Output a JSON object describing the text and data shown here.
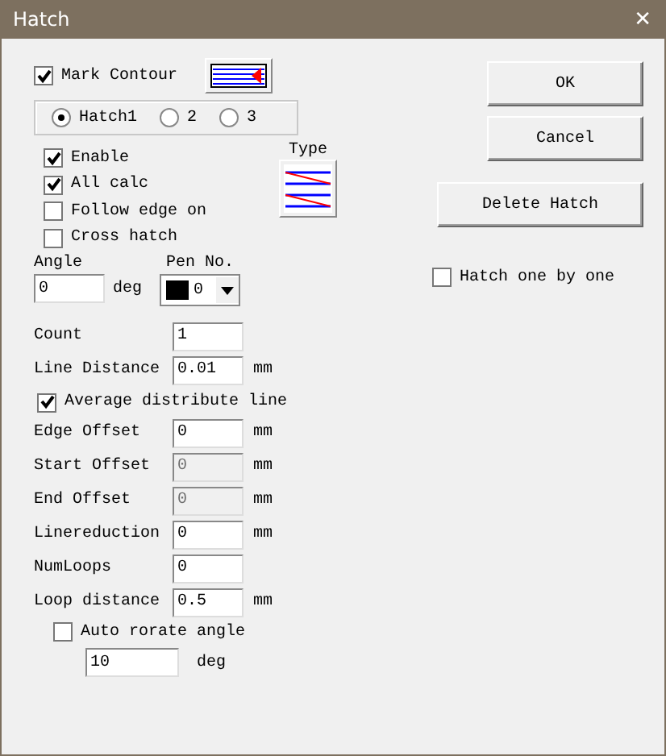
{
  "window": {
    "title": "Hatch",
    "close": "✕"
  },
  "mark_contour": {
    "label": "Mark Contour",
    "checked": true
  },
  "hatch_radios": [
    {
      "label": "Hatch1",
      "selected": true
    },
    {
      "label": "2",
      "selected": false
    },
    {
      "label": "3",
      "selected": false
    }
  ],
  "options": [
    {
      "label": "Enable",
      "checked": true
    },
    {
      "label": "All calc",
      "checked": true
    },
    {
      "label": "Follow edge on",
      "checked": false
    },
    {
      "label": "Cross hatch",
      "checked": false
    }
  ],
  "type_label": "Type",
  "angle": {
    "label": "Angle",
    "value": "0",
    "unit": "deg"
  },
  "pen": {
    "label": "Pen No.",
    "value": "0"
  },
  "fields": [
    {
      "kind": "field",
      "label": "Count",
      "value": "1",
      "disabled": false
    },
    {
      "kind": "field",
      "label": "Line Distance",
      "value": "0.01",
      "unit": "mm",
      "disabled": false
    },
    {
      "kind": "check",
      "label": "Average distribute line",
      "checked": true
    },
    {
      "kind": "field",
      "label": "Edge Offset",
      "value": "0",
      "unit": "mm",
      "disabled": false
    },
    {
      "kind": "field",
      "label": "Start Offset",
      "value": "0",
      "unit": "mm",
      "disabled": true
    },
    {
      "kind": "field",
      "label": "End Offset",
      "value": "0",
      "unit": "mm",
      "disabled": true
    },
    {
      "kind": "field",
      "label": "Linereduction",
      "value": "0",
      "unit": "mm",
      "disabled": false
    },
    {
      "kind": "field",
      "label": "NumLoops",
      "value": "0",
      "disabled": false
    },
    {
      "kind": "field",
      "label": "Loop distance",
      "value": "0.5",
      "unit": "mm",
      "disabled": false
    }
  ],
  "auto_rotate": {
    "label": "Auto rorate angle",
    "checked": false,
    "value": "10",
    "unit": "deg"
  },
  "buttons": {
    "ok": "OK",
    "cancel": "Cancel",
    "delete": "Delete Hatch"
  },
  "hatch_one_by_one": {
    "label": "Hatch one by one",
    "checked": false
  }
}
